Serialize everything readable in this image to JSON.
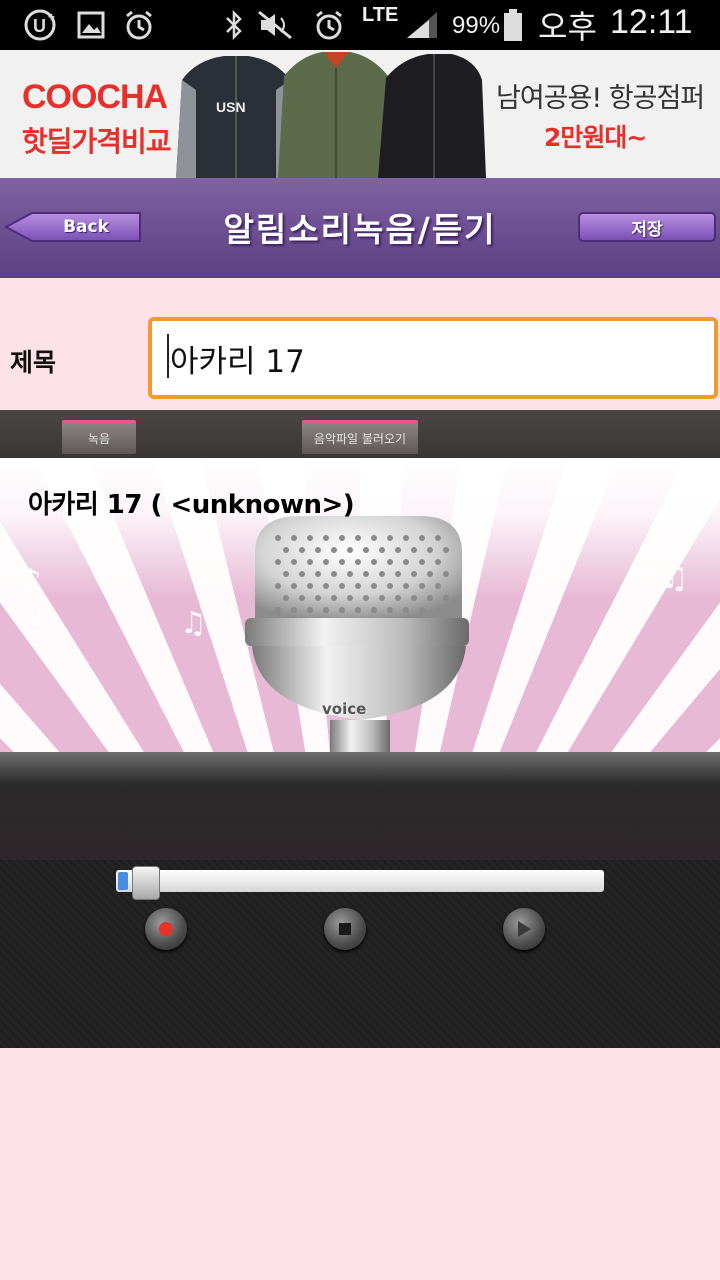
{
  "status_bar": {
    "battery": "99%",
    "ampm": "오후",
    "time": "12:11",
    "network": "LTE"
  },
  "ad": {
    "brand_line1": "COOCHA",
    "brand_line2": "핫딜가격비교",
    "jacket_text": "USN",
    "promo_line1": "남여공용! 항공점퍼",
    "promo_line2": "2만원대~"
  },
  "header": {
    "back_label": "Back",
    "title": "알림소리녹음/듣기",
    "save_label": "저장"
  },
  "form": {
    "title_label": "제목",
    "title_value": "아카리 17"
  },
  "tabs": [
    {
      "label": "녹음"
    },
    {
      "label": "음악파일 불러오기"
    }
  ],
  "mic_panel": {
    "now_playing": "아카리 17 ( <unknown>)",
    "mic_brand": "voice"
  },
  "player": {
    "progress_fraction": 0.02
  },
  "colors": {
    "header": "#6f5193",
    "background": "#fde3e8",
    "input_border": "#f19a30",
    "ad_red": "#e8302a"
  },
  "icons": [
    "u-plus-icon",
    "gallery-icon",
    "alarm-icon",
    "bluetooth-icon",
    "mute-icon",
    "alarm-clock-icon",
    "signal-icon",
    "battery-icon",
    "record-icon",
    "stop-icon",
    "play-icon",
    "microphone-icon",
    "music-note-icon"
  ]
}
